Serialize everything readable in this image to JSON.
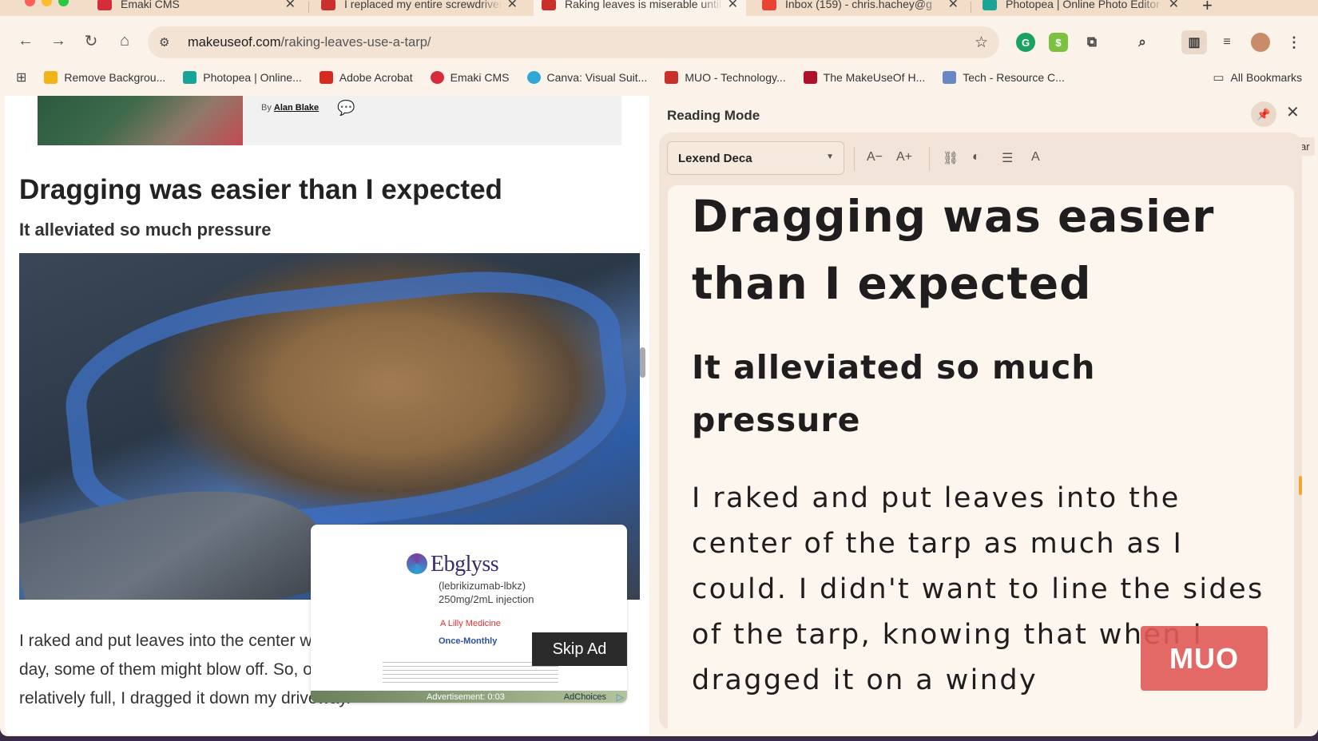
{
  "browser": {
    "tabs": [
      {
        "title": "Emaki CMS",
        "favicon_color": "#d62b3a"
      },
      {
        "title": "I replaced my entire screwdriver",
        "favicon_color": "#c9302c"
      },
      {
        "title": "Raking leaves is miserable until",
        "favicon_color": "#c9302c",
        "active": true
      },
      {
        "title": "Inbox (159) - chris.hachey@g",
        "favicon_color": "#ea4335"
      },
      {
        "title": "Photopea | Online Photo Editor",
        "favicon_color": "#18a497"
      }
    ],
    "new_tab_icon": "+",
    "url_prefix": "makeuseof.com",
    "url_path": "/raking-leaves-use-a-tarp/",
    "bookmarks": [
      {
        "label": "Remove Backgrou...",
        "icon_color": "#f2b318"
      },
      {
        "label": "Photopea | Online...",
        "icon_color": "#18a497"
      },
      {
        "label": "Adobe Acrobat",
        "icon_color": "#d62b20"
      },
      {
        "label": "Emaki CMS",
        "icon_color": "#d62b3a"
      },
      {
        "label": "Canva: Visual Suit...",
        "icon_color": "#2fa8d6"
      },
      {
        "label": "MUO - Technology...",
        "icon_color": "#c9302c"
      },
      {
        "label": "The MakeUseOf H...",
        "icon_color": "#b0102a"
      },
      {
        "label": "Tech - Resource C...",
        "icon_color": "#6a86c4"
      }
    ],
    "all_bookmarks": "All Bookmarks"
  },
  "article": {
    "byline_prefix": "By",
    "author": "Alan Blake",
    "heading": "Dragging was easier than I expected",
    "subheading": "It alleviated so much pressure",
    "body": "I raked and put leaves into the center want to line the sides of the tarp, kno day, some of them might blow off. So, once the middle of the tarp was relatively full, I dragged it down my driveway."
  },
  "ad": {
    "brand": "Ebglyss",
    "subtitle": "(lebrikizumab-lbkz) 250mg/2mL injection",
    "maker": "A Lilly Medicine",
    "dosing": "Once-Monthly",
    "skip_label": "Skip Ad",
    "status": "Advertisement: 0:03",
    "adchoices": "AdChoices"
  },
  "reading_mode": {
    "title": "Reading Mode",
    "pin_tooltip": "Pin to toolbar",
    "font": "Lexend Deca",
    "heading": "Dragging was easier than I expected",
    "subheading": "It alleviated so much pressure",
    "paragraph": "I raked and put leaves into the center of the tarp as much as I could. I didn't want to line the sides of the tarp, knowing that when I dragged it on a windy"
  },
  "watermark": "MUO"
}
